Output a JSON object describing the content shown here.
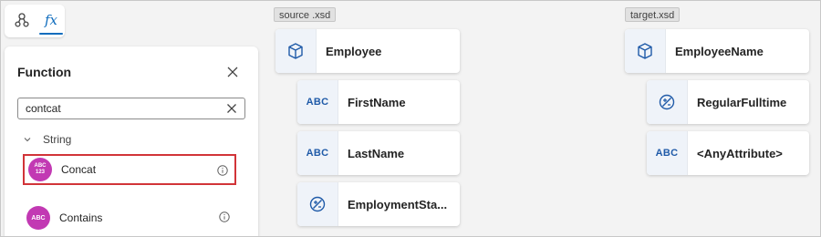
{
  "toolbar": {
    "map_icon": "mapping-graph-icon",
    "fx_icon": "function-icon",
    "fx_label": "fx"
  },
  "panel": {
    "title": "Function",
    "search": {
      "value": "contcat",
      "placeholder": ""
    },
    "category": "String",
    "functions": [
      {
        "label": "Concat",
        "icon_text_top": "ABC",
        "icon_text_bottom": "123",
        "selected": true
      },
      {
        "label": "Contains",
        "icon_text": "ABC",
        "selected": false
      }
    ]
  },
  "source": {
    "tag": "source .xsd",
    "root": {
      "label": "Employee",
      "icon": "cube-icon"
    },
    "children": [
      {
        "label": "FirstName",
        "icon": "ABC"
      },
      {
        "label": "LastName",
        "icon": "ABC"
      },
      {
        "label": "EmploymentSta...",
        "icon": "decimal-icon"
      }
    ]
  },
  "target": {
    "tag": "target.xsd",
    "root": {
      "label": "EmployeeName",
      "icon": "cube-icon"
    },
    "children": [
      {
        "label": "RegularFulltime",
        "icon": "decimal-icon"
      },
      {
        "label": "<AnyAttribute>",
        "icon": "ABC"
      }
    ]
  },
  "colors": {
    "accent": "#0f6cbd",
    "function_icon": "#c239b3",
    "selection_border": "#d13438",
    "node_icon_bg": "#eff3f9"
  }
}
